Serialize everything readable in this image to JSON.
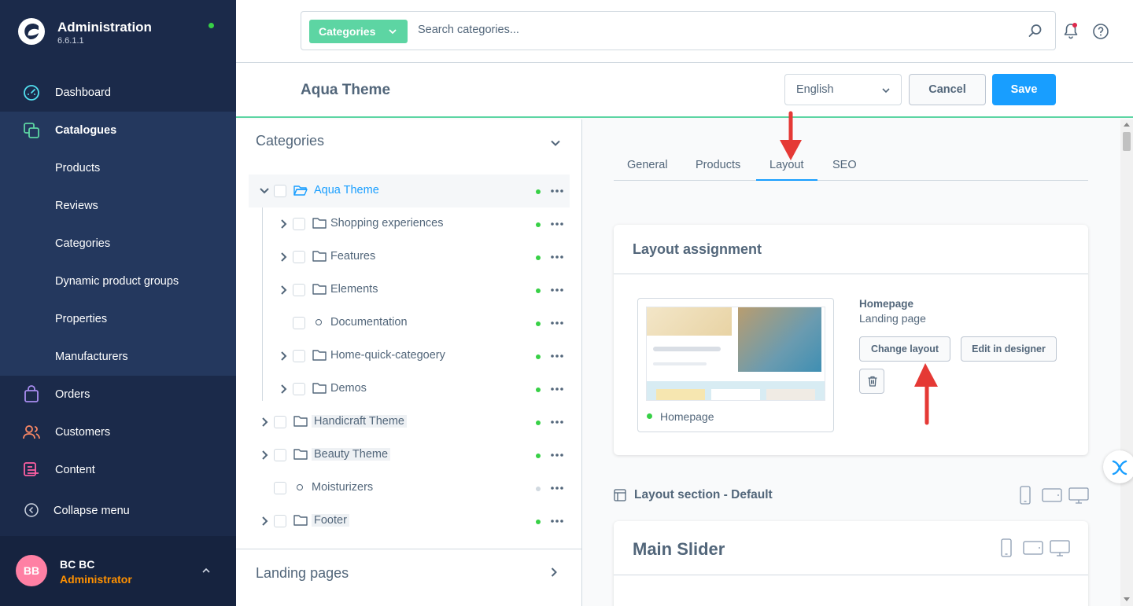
{
  "sidebar": {
    "title": "Administration",
    "version": "6.6.1.1",
    "items": [
      {
        "label": "Dashboard",
        "icon": "gauge-icon"
      },
      {
        "label": "Catalogues",
        "icon": "catalogue-icon"
      },
      {
        "label": "Products"
      },
      {
        "label": "Reviews"
      },
      {
        "label": "Categories"
      },
      {
        "label": "Dynamic product groups"
      },
      {
        "label": "Properties"
      },
      {
        "label": "Manufacturers"
      },
      {
        "label": "Orders",
        "icon": "shopping-bag-icon"
      },
      {
        "label": "Customers",
        "icon": "users-icon"
      },
      {
        "label": "Content",
        "icon": "content-icon"
      }
    ],
    "collapse_label": "Collapse menu",
    "user": {
      "initials": "BB",
      "name": "BC BC",
      "role": "Administrator"
    }
  },
  "topbar": {
    "search_type": "Categories",
    "search_placeholder": "Search categories..."
  },
  "smartbar": {
    "title": "Aqua Theme",
    "language": "English",
    "cancel_label": "Cancel",
    "save_label": "Save"
  },
  "tree": {
    "heading": "Categories",
    "items": [
      {
        "name": "Aqua Theme",
        "active": true
      },
      {
        "name": "Shopping experiences",
        "active": true
      },
      {
        "name": "Features",
        "active": true
      },
      {
        "name": "Elements",
        "active": true
      },
      {
        "name": "Documentation",
        "active": true
      },
      {
        "name": "Home-quick-categoery",
        "active": true
      },
      {
        "name": "Demos",
        "active": true
      },
      {
        "name": "Handicraft Theme",
        "active": true
      },
      {
        "name": "Beauty Theme",
        "active": true
      },
      {
        "name": "Moisturizers",
        "active": false
      },
      {
        "name": "Footer",
        "active": true
      }
    ],
    "landing_pages_label": "Landing pages"
  },
  "tabs": [
    "General",
    "Products",
    "Layout",
    "SEO"
  ],
  "active_tab": "Layout",
  "layout_assignment": {
    "title": "Layout assignment",
    "preview_name": "Homepage",
    "layout_name": "Homepage",
    "layout_type": "Landing page",
    "change_layout_label": "Change layout",
    "edit_designer_label": "Edit in designer"
  },
  "layout_section": {
    "label": "Layout section - Default",
    "block_title": "Main Slider"
  },
  "colors": {
    "sidebar_bg": "#1b2a4a",
    "accent_blue": "#189eff",
    "accent_green": "#5dd5a3",
    "annotation_red": "#e53935"
  }
}
